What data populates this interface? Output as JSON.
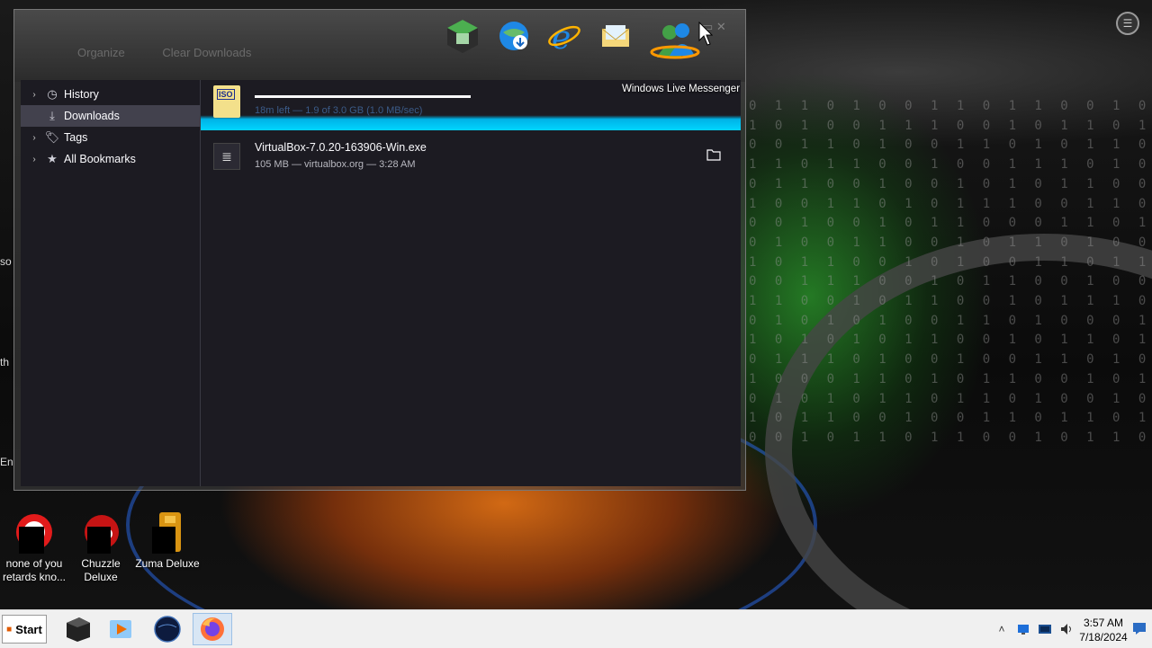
{
  "window": {
    "toolbar": {
      "organize": "Organize",
      "clear_downloads": "Clear Downloads"
    },
    "sidebar": {
      "items": [
        {
          "label": "History",
          "icon": "clock-icon",
          "expandable": true,
          "selected": false
        },
        {
          "label": "Downloads",
          "icon": "download-icon",
          "expandable": false,
          "selected": true
        },
        {
          "label": "Tags",
          "icon": "tag-icon",
          "expandable": true,
          "selected": false
        },
        {
          "label": "All Bookmarks",
          "icon": "star-icon",
          "expandable": true,
          "selected": false
        }
      ]
    },
    "downloads": {
      "active": {
        "icon_text": "ISO",
        "progress_fraction": 0.53,
        "meta": "18m left — 1.9 of 3.0 GB (1.0 MB/sec)"
      },
      "completed": {
        "name": "VirtualBox-7.0.20-163906-Win.exe",
        "meta": "105 MB — virtualbox.org — 3:28 AM"
      }
    }
  },
  "launcher": {
    "icons": [
      "minecraft-launcher-icon",
      "globe-download-icon",
      "internet-explorer-icon",
      "mail-icon",
      "windows-live-messenger-icon"
    ],
    "hover_label": "Windows Live Messenger"
  },
  "desktop": {
    "icons": [
      {
        "label_line1": "none of you",
        "label_line2": "retards kno...",
        "icon": "red-circle-app-icon"
      },
      {
        "label_line1": "Chuzzle",
        "label_line2": "Deluxe",
        "icon": "chuzzle-icon"
      },
      {
        "label_line1": "Zuma Deluxe",
        "label_line2": "",
        "icon": "zuma-icon"
      }
    ],
    "clipped_texts": [
      "so",
      "th",
      "En"
    ]
  },
  "taskbar": {
    "start_label": "Start",
    "apps": [
      "terminal-app-icon",
      "media-player-icon",
      "globe-app-icon",
      "firefox-icon"
    ],
    "clock_time": "3:57 AM",
    "clock_date": "7/18/2024"
  },
  "colors": {
    "accent": "#00d5ff",
    "window_bg": "#1c1b22",
    "selected_bg": "#42414d"
  }
}
